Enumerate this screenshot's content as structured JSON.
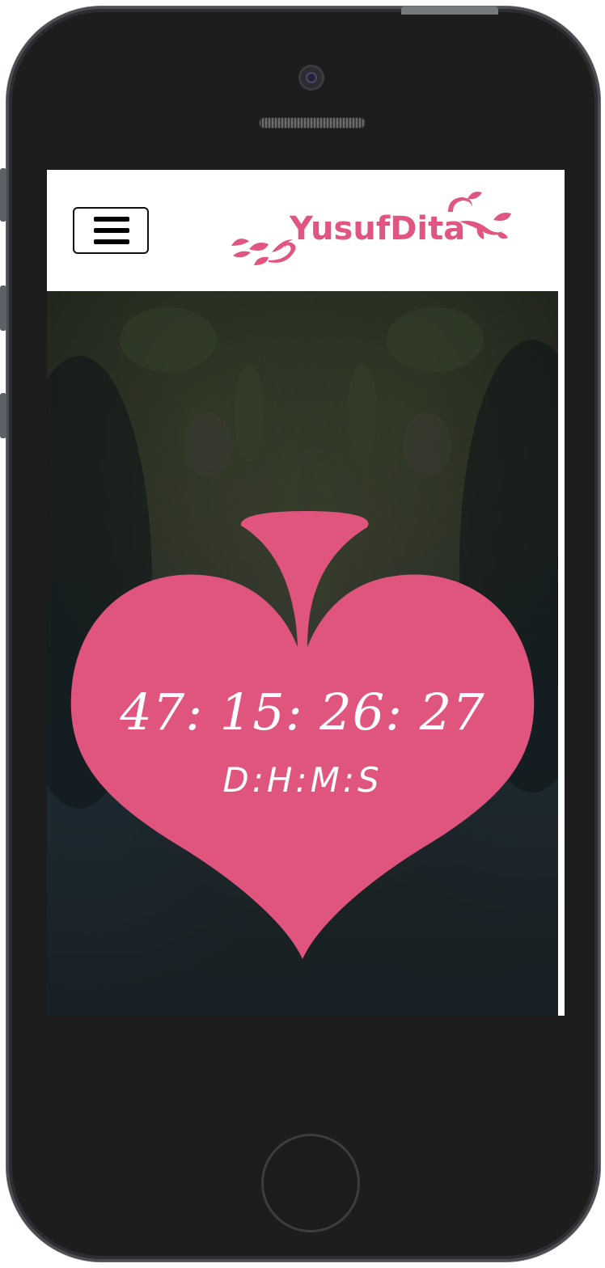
{
  "header": {
    "logo_text": "YusufDita",
    "menu_icon": "hamburger-menu-icon"
  },
  "countdown": {
    "value": "47: 15: 26: 27",
    "units": "D:H:M:S"
  },
  "colors": {
    "accent": "#e05680",
    "heart": "#e0557e",
    "phone_body": "#1d1d1d"
  }
}
